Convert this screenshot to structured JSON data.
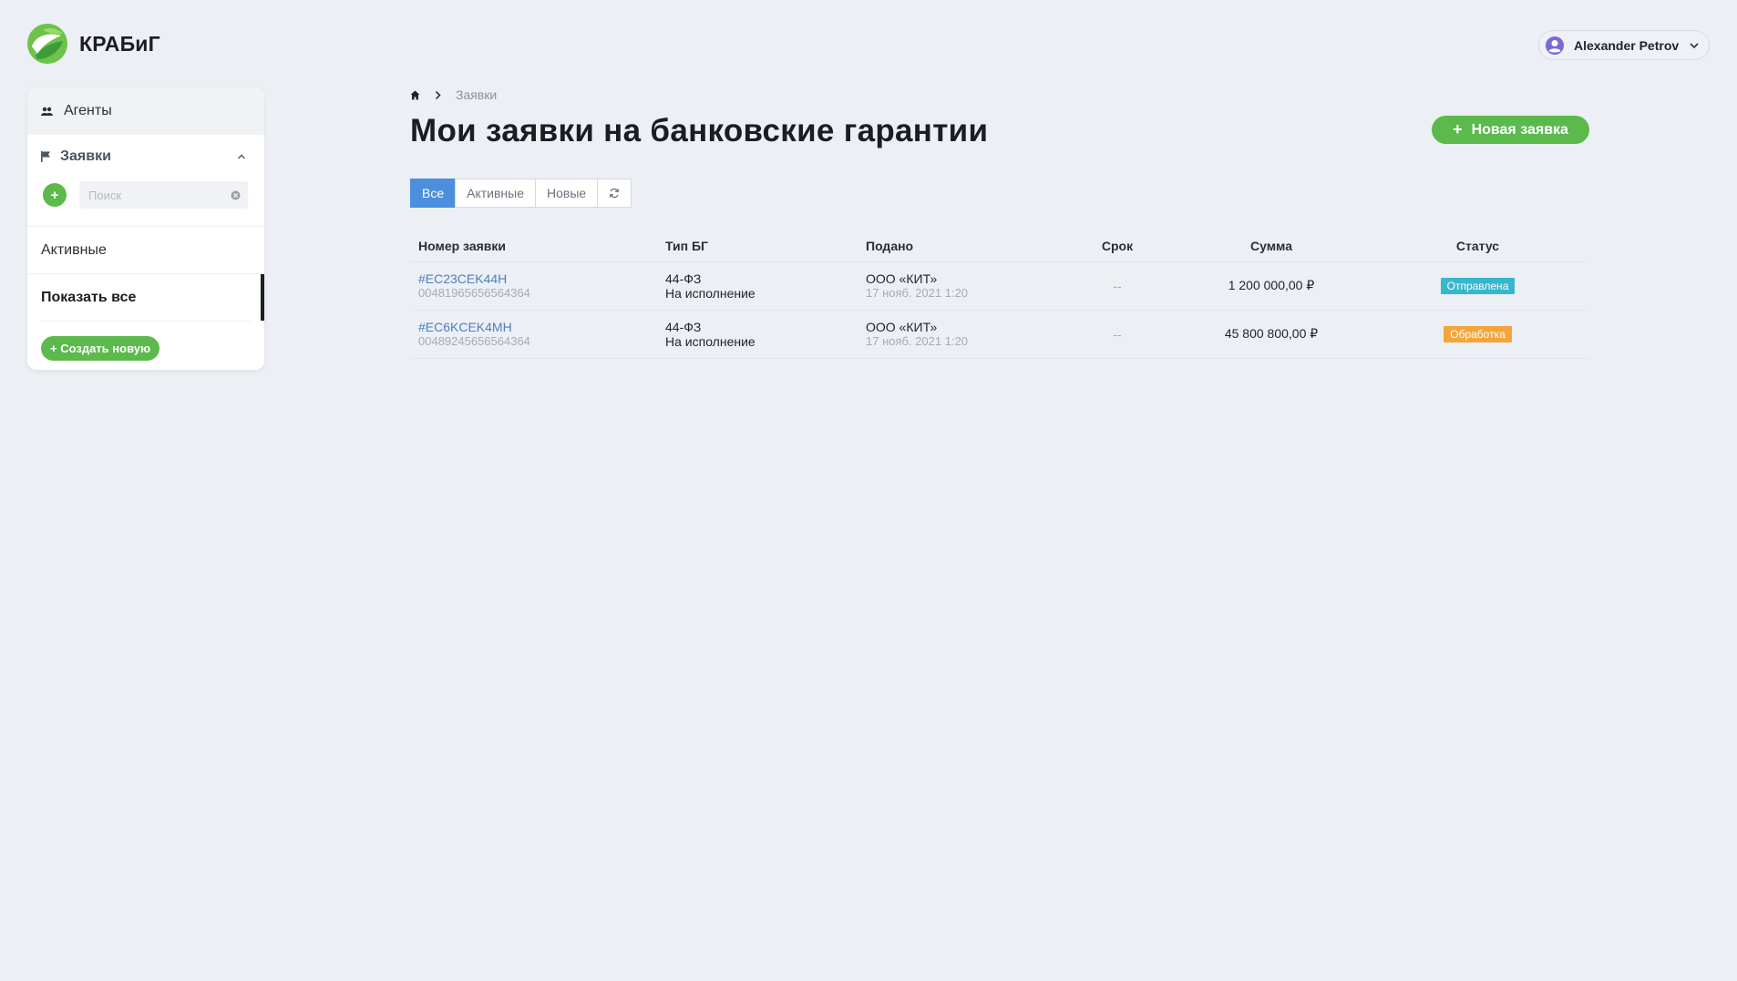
{
  "app": {
    "brand": "КРАБиГ"
  },
  "user": {
    "name": "Alexander Petrov"
  },
  "sidebar": {
    "agents_label": "Агенты",
    "section_label": "Заявки",
    "search_placeholder": "Поиск",
    "items": [
      {
        "label": "Активные"
      },
      {
        "label": "Показать все"
      }
    ],
    "create_label": "+ Создать новую"
  },
  "breadcrumb": {
    "current": "Заявки"
  },
  "page": {
    "title": "Мои заявки на банковские гарантии",
    "new_button": "Новая заявка"
  },
  "filters": [
    "Все",
    "Активные",
    "Новые"
  ],
  "table": {
    "headers": [
      "Номер заявки",
      "Тип БГ",
      "Подано",
      "Срок",
      "Сумма",
      "Статус"
    ],
    "rows": [
      {
        "id": "#EC23CEK44H",
        "sub": "00481965656564364",
        "type": "44-ФЗ",
        "type_sub": "На исполнение",
        "org": "ООО «КИТ»",
        "date": "17 нояб. 2021 1:20",
        "term": "--",
        "amount": "1 200 000,00 ₽",
        "status": "Отправлена",
        "status_color": "#36b8cc"
      },
      {
        "id": "#EC6KCEK4MH",
        "sub": "00489245656564364",
        "type": "44-ФЗ",
        "type_sub": "На исполнение",
        "org": "ООО «КИТ»",
        "date": "17 нояб. 2021 1:20",
        "term": "--",
        "amount": "45 800 800,00 ₽",
        "status": "Обработка",
        "status_color": "#f4a53a"
      }
    ]
  }
}
